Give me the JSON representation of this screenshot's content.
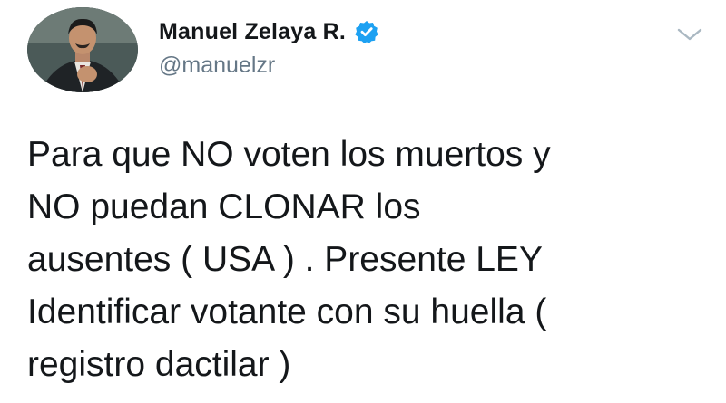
{
  "author": {
    "display_name": "Manuel Zelaya R.",
    "handle": "@manuelzr",
    "verified": true,
    "avatar_icon": "profile-photo"
  },
  "menu": {
    "icon": "chevron-down-icon"
  },
  "tweet": {
    "lines": [
      "Para que NO voten los muertos y",
      "NO puedan CLONAR los",
      "ausentes ( USA ) . Presente LEY",
      "Identificar votante con su huella (",
      "registro dactilar )"
    ]
  },
  "colors": {
    "text": "#14171a",
    "secondary": "#657786",
    "verified_badge": "#1da1f2",
    "caret": "#aab8c2"
  }
}
